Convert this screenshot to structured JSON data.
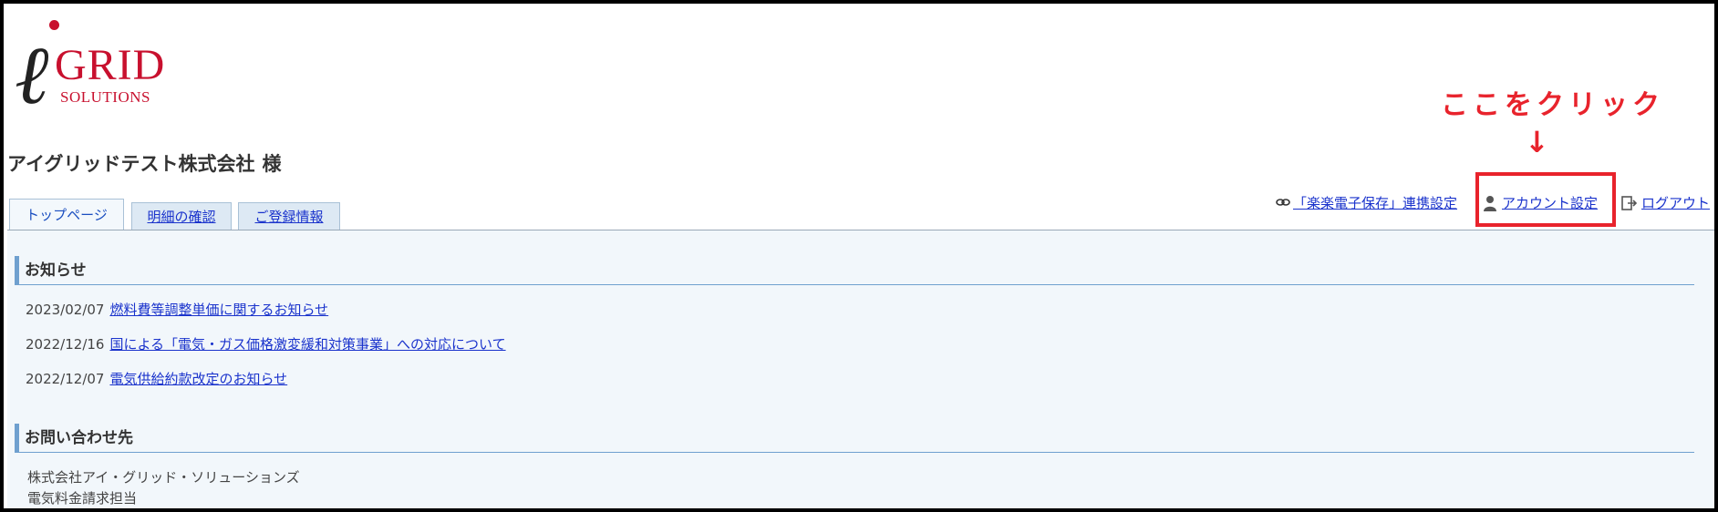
{
  "logo": {
    "grid": "GRID",
    "solutions": "SOLUTIONS"
  },
  "company": {
    "name": "アイグリッドテスト株式会社",
    "suffix": "様"
  },
  "annotation": {
    "text": "ここをクリック",
    "arrow": "↓",
    "color": "#e8232c"
  },
  "tabs": [
    {
      "label": "トップページ",
      "active": true
    },
    {
      "label": "明細の確認",
      "active": false
    },
    {
      "label": "ご登録情報",
      "active": false
    }
  ],
  "header_links": {
    "rakuraku": {
      "label": "「楽楽電子保存」連携設定",
      "icon": "link-icon"
    },
    "account": {
      "label": "アカウント設定",
      "icon": "user-icon"
    },
    "logout": {
      "label": "ログアウト",
      "icon": "logout-icon"
    }
  },
  "notices": {
    "heading": "お知らせ",
    "items": [
      {
        "date": "2023/02/07",
        "title": "燃料費等調整単価に関するお知らせ"
      },
      {
        "date": "2022/12/16",
        "title": "国による「電気・ガス価格激変緩和対策事業」への対応について"
      },
      {
        "date": "2022/12/07",
        "title": "電気供給約款改定のお知らせ"
      }
    ]
  },
  "contact": {
    "heading": "お問い合わせ先",
    "lines": [
      "株式会社アイ・グリッド・ソリューションズ",
      "電気料金請求担当"
    ]
  },
  "colors": {
    "brand": "#c8102e",
    "link": "#1a33cc",
    "accent": "#6fa0cf"
  }
}
